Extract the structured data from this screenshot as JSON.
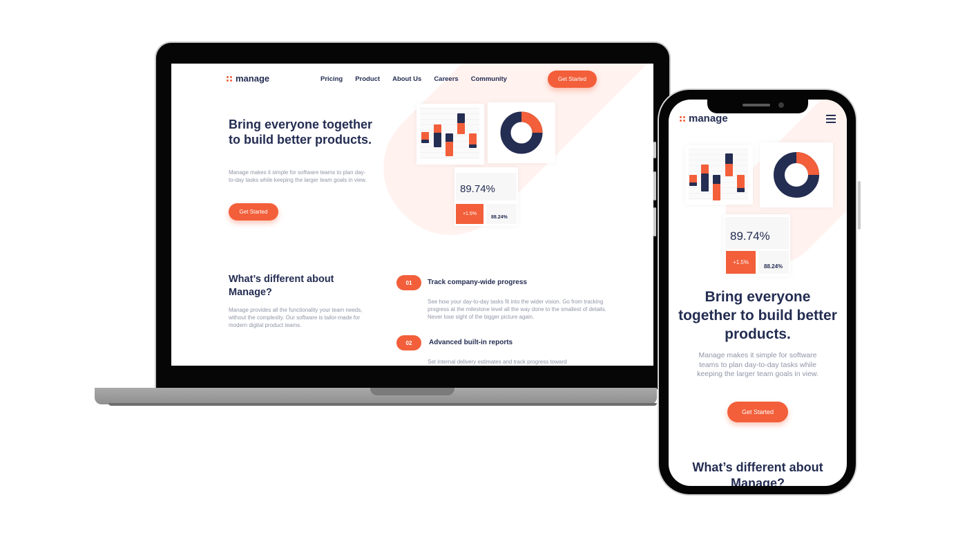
{
  "brand": {
    "name": "manage",
    "accent": "#f25f3a",
    "navy": "#242d52",
    "muted": "#9095a7"
  },
  "nav": {
    "items": [
      "Pricing",
      "Product",
      "About Us",
      "Careers",
      "Community"
    ],
    "cta": "Get Started"
  },
  "hero": {
    "title": "Bring everyone together to build better products.",
    "description": "Manage makes it simple for software teams to plan day-to-day tasks while keeping the larger team goals in view.",
    "cta": "Get Started"
  },
  "stats": {
    "main": "89.74%",
    "change": "+1.5%",
    "secondary": "88.24%"
  },
  "different": {
    "title": "What’s different about Manage?",
    "description": "Manage provides all the functionality your team needs, without the complexity. Our software is tailor-made for modern digital product teams."
  },
  "features": [
    {
      "number": "01",
      "title": "Track company-wide progress",
      "description": "See how your day-to-day tasks fit into the wider vision. Go from tracking progress at the milestone level all the way done to the smallest of details. Never lose sight of the bigger picture again."
    },
    {
      "number": "02",
      "title": "Advanced built-in reports",
      "description": "Set internal delivery estimates and track progress toward"
    }
  ],
  "mobile": {
    "menu_icon": "hamburger-menu-icon"
  }
}
